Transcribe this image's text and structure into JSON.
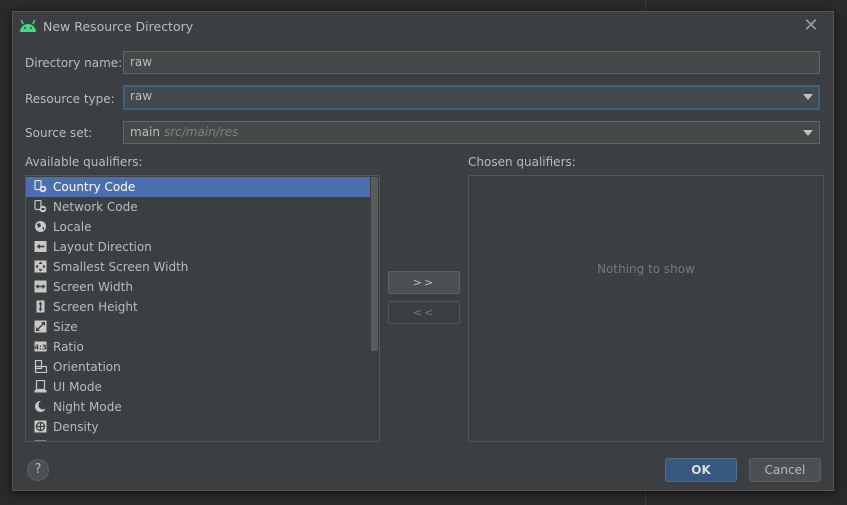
{
  "dialog": {
    "title": "New Resource Directory",
    "close_glyph": "✕"
  },
  "form": {
    "directory_name_label": "Directory name:",
    "directory_name_value": "raw",
    "resource_type_label": "Resource type:",
    "resource_type_value": "raw",
    "source_set_label": "Source set:",
    "source_set_value": "main",
    "source_set_path": "src/main/res"
  },
  "qualifiers": {
    "available_label": "Available qualifiers:",
    "chosen_label": "Chosen qualifiers:",
    "chosen_empty": "Nothing to show",
    "add_label": ">>",
    "remove_label": "<<",
    "items": [
      {
        "label": "Country Code",
        "icon": "country-code-icon"
      },
      {
        "label": "Network Code",
        "icon": "network-code-icon"
      },
      {
        "label": "Locale",
        "icon": "globe-icon"
      },
      {
        "label": "Layout Direction",
        "icon": "layout-direction-icon"
      },
      {
        "label": "Smallest Screen Width",
        "icon": "smallest-width-icon"
      },
      {
        "label": "Screen Width",
        "icon": "screen-width-icon"
      },
      {
        "label": "Screen Height",
        "icon": "screen-height-icon"
      },
      {
        "label": "Size",
        "icon": "size-icon"
      },
      {
        "label": "Ratio",
        "icon": "ratio-icon"
      },
      {
        "label": "Orientation",
        "icon": "orientation-icon"
      },
      {
        "label": "UI Mode",
        "icon": "ui-mode-icon"
      },
      {
        "label": "Night Mode",
        "icon": "night-mode-icon"
      },
      {
        "label": "Density",
        "icon": "density-icon"
      }
    ]
  },
  "buttons": {
    "help": "?",
    "ok": "OK",
    "cancel": "Cancel"
  },
  "colors": {
    "selection": "#4b6eaf",
    "focus_border": "#3d6185",
    "ok_button": "#365880",
    "android_green": "#3ddc84"
  }
}
